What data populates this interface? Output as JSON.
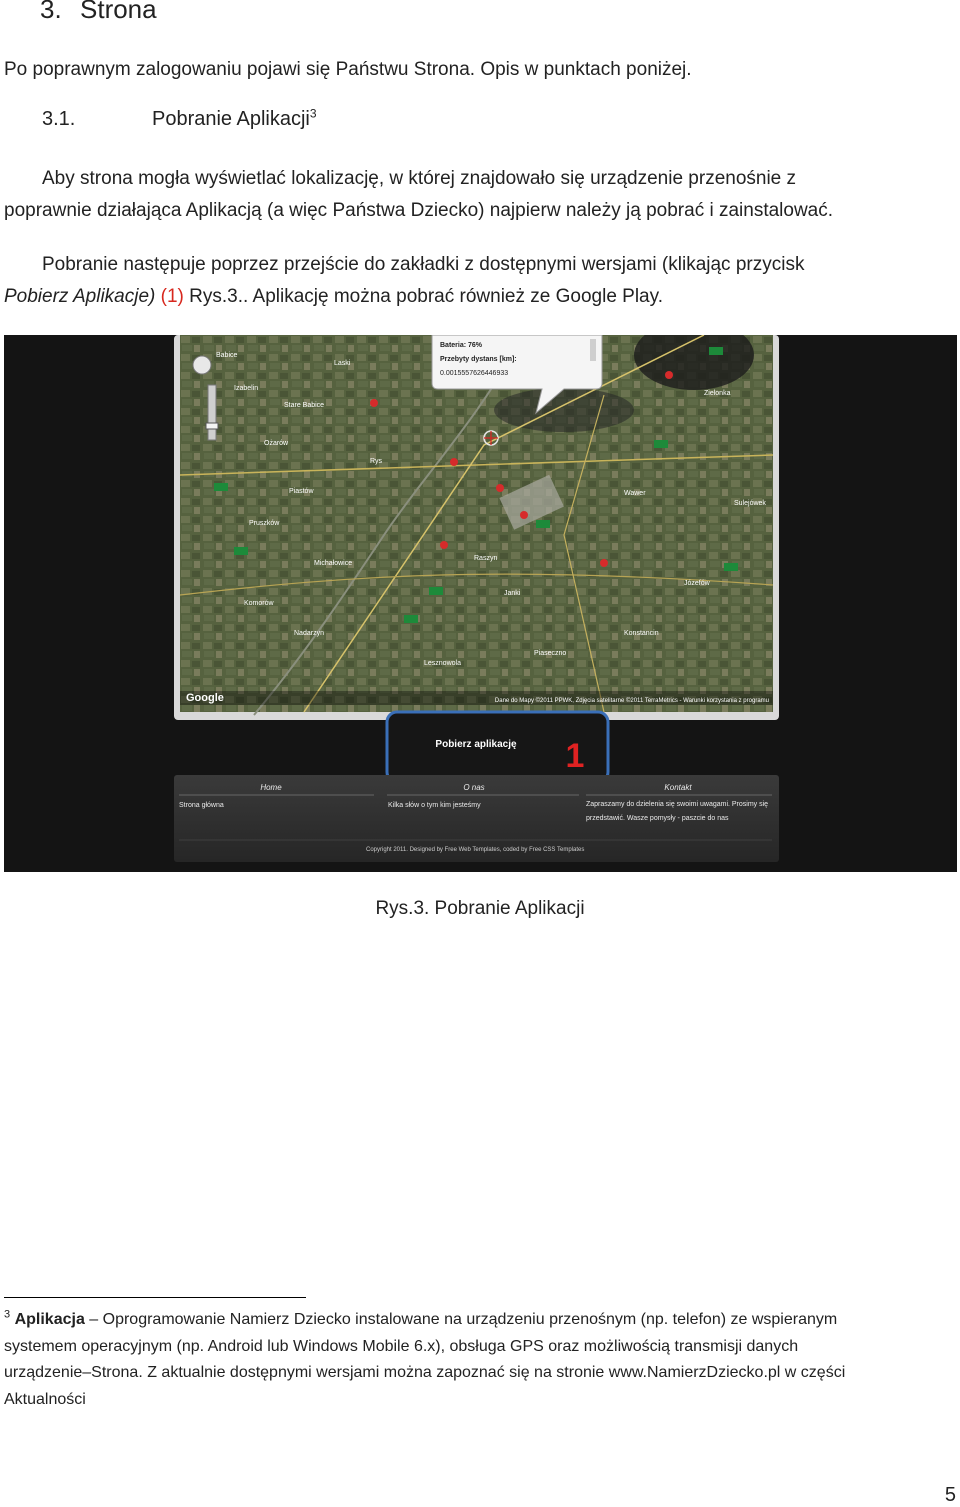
{
  "section": {
    "number": "3.",
    "title": "Strona"
  },
  "intro": "Po poprawnym zalogowaniu pojawi się Państwu Strona. Opis w punktach poniżej.",
  "subsection": {
    "number": "3.1.",
    "title": "Pobranie Aplikacji",
    "footnote_ref": "3"
  },
  "para1": {
    "line1": "Aby strona mogła wyświetlać lokalizację, w której znajdowało się urządzenie przenośnie z",
    "line2": "poprawnie działająca Aplikacją (a więc Państwa Dziecko) najpierw należy ją pobrać i zainstalować."
  },
  "para2": {
    "line1": "Pobranie następuje poprzez przejście do zakładki z dostępnymi wersjami (klikając przycisk",
    "italic": "Pobierz Aplikacje)",
    "marker": "(1)",
    "rest": " Rys.3.. Aplikację można pobrać również ze Google Play."
  },
  "figure": {
    "popup": [
      "Bateria: 76%",
      "Przebyty dystans [km]:",
      "0.0015557626446933"
    ],
    "map_places": [
      "Babice",
      "Laski",
      "Izabelin",
      "Stare Babice",
      "Ożarów",
      "Rys",
      "Piastów",
      "Pruszków",
      "Raszyn",
      "Janki",
      "Michałowice",
      "Komorów",
      "Nadarzyn",
      "Lesznowola",
      "Piaseczno",
      "Konstancin",
      "Józefów",
      "Wawer",
      "Zielonka",
      "Sulejówek"
    ],
    "map_attribution": "Dane do Mapy ©2011 PPWK, Zdjęcia satelitarne ©2011 TerraMetrics - Warunki korzystania z programu",
    "map_logo": "Google",
    "download_button": "Pobierz aplikację",
    "callout_number": "1",
    "footer_cols": [
      {
        "heading": "Home",
        "text": "Strona główna"
      },
      {
        "heading": "O nas",
        "text": "Kilka słów o tym kim jesteśmy"
      },
      {
        "heading": "Kontakt",
        "text": "Zapraszamy do dzielenia się swoimi uwagami. Prosimy się przedstawić. Wasze pomysły - paszcie do nas"
      }
    ],
    "copyright": "Copyright 2011. Designed by Free Web Templates, coded by Free CSS Templates",
    "colors": {
      "callout_border": "#3a6fb8",
      "callout_number": "#e02222",
      "map_bg": "#4b5a3a"
    }
  },
  "caption": "Rys.3. Pobranie Aplikacji",
  "footnote": {
    "ref": "3",
    "bold": "Aplikacja",
    "line1": " – Oprogramowanie Namierz Dziecko instalowane na urządzeniu przenośnym (np. telefon) ze wspieranym",
    "line2": "systemem operacyjnym (np. Android lub Windows Mobile 6.x), obsługa GPS oraz możliwością transmisji danych",
    "line3": "urządzenie–Strona. Z aktualnie dostępnymi wersjami można zapoznać się na stronie www.NamierzDziecko.pl w części",
    "line4": "Aktualności"
  },
  "page_number": "5"
}
